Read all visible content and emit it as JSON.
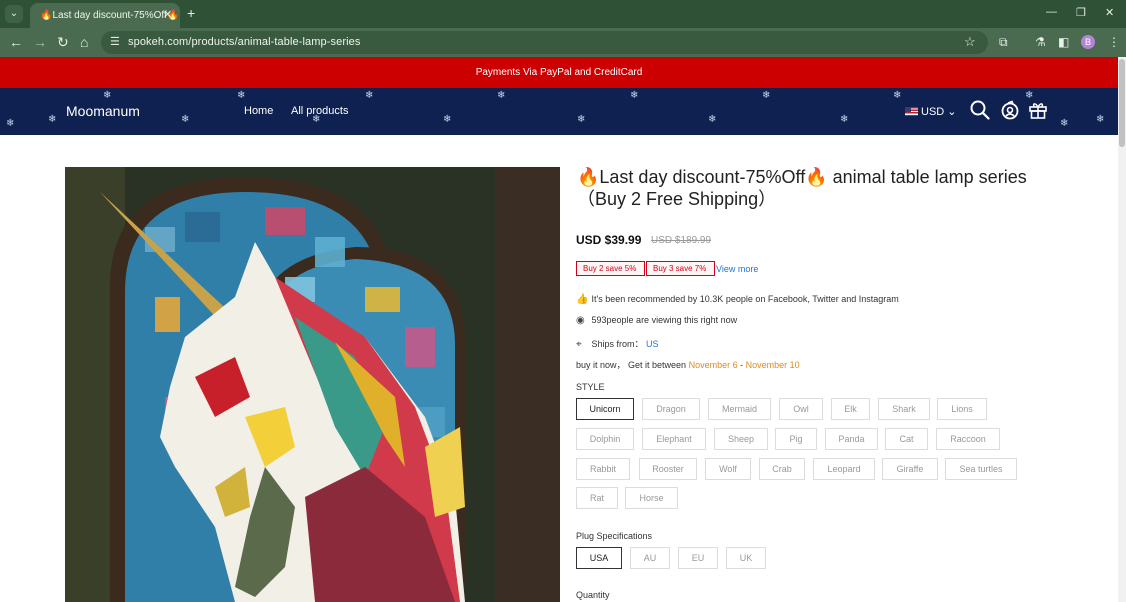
{
  "browser": {
    "tab_title": "🔥Last day discount-75%Off🔥",
    "url": "spokeh.com/products/animal-table-lamp-series",
    "profile_initial": "B"
  },
  "announcement": "Payments Via PayPal and CreditCard",
  "header": {
    "logo": "Moomanum",
    "nav": [
      "Home",
      "All products"
    ],
    "currency": "USD"
  },
  "product": {
    "title": "🔥Last day discount-75%Off🔥 animal table lamp series（Buy 2 Free Shipping）",
    "price": "USD $39.99",
    "old_price": "USD $189.99",
    "promos": [
      "Buy 2 save 5%",
      "Buy 3 save 7%"
    ],
    "view_more": "View more",
    "recommended": "It's been recommended by 10.3K people on Facebook, Twitter and Instagram",
    "viewing": "593people are viewing this right now",
    "ships_label": "Ships from：",
    "ships_value": "US",
    "delivery_prefix": "buy it now，  Get it between",
    "delivery_start": "November 6",
    "delivery_sep": " - ",
    "delivery_end": "November 10",
    "style_label": "STYLE",
    "styles": [
      "Unicorn",
      "Dragon",
      "Mermaid",
      "Owl",
      "Elk",
      "Shark",
      "Lions",
      "Dolphin",
      "Elephant",
      "Sheep",
      "Pig",
      "Panda",
      "Cat",
      "Raccoon",
      "Rabbit",
      "Rooster",
      "Wolf",
      "Crab",
      "Leopard",
      "Giraffe",
      "Sea turtles",
      "Rat",
      "Horse"
    ],
    "selected_style": "Unicorn",
    "plug_label": "Plug Specifications",
    "plugs": [
      "USA",
      "AU",
      "EU",
      "UK"
    ],
    "selected_plug": "USA",
    "quantity_label": "Quantity"
  },
  "colors": {
    "announcement_bg": "#cc0000",
    "header_bg": "#0e2150",
    "promo_red": "#d0021b",
    "link_blue": "#1f74d6",
    "date_orange": "#e08a1e"
  }
}
